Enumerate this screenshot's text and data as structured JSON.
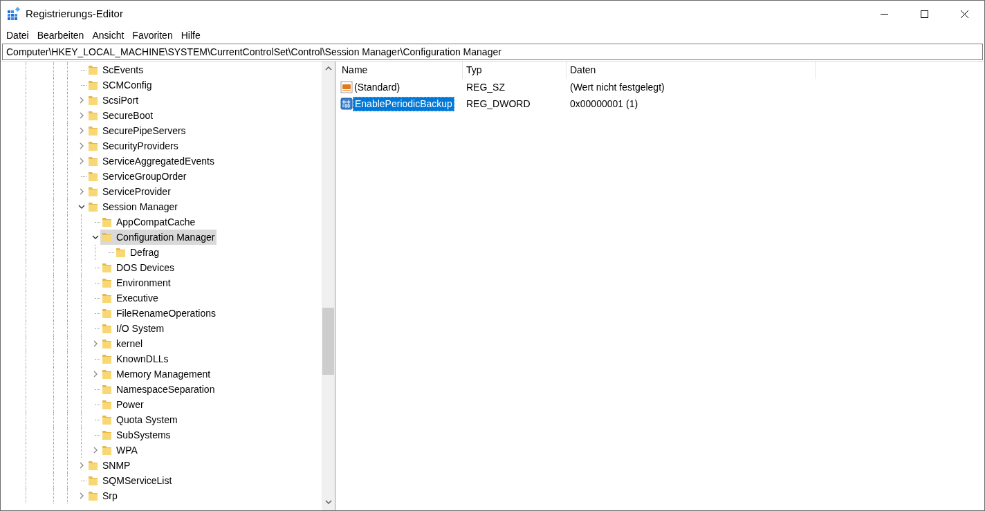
{
  "window": {
    "title": "Registrierungs-Editor"
  },
  "menu": [
    "Datei",
    "Bearbeiten",
    "Ansicht",
    "Favoriten",
    "Hilfe"
  ],
  "address": "Computer\\HKEY_LOCAL_MACHINE\\SYSTEM\\CurrentControlSet\\Control\\Session Manager\\Configuration Manager",
  "tree": [
    {
      "label": "ScEvents",
      "kind": "leaf",
      "selected": false
    },
    {
      "label": "SCMConfig",
      "kind": "leaf",
      "selected": false
    },
    {
      "label": "ScsiPort",
      "kind": "expandable",
      "expanded": false,
      "selected": false
    },
    {
      "label": "SecureBoot",
      "kind": "expandable",
      "expanded": false,
      "selected": false
    },
    {
      "label": "SecurePipeServers",
      "kind": "expandable",
      "expanded": false,
      "selected": false
    },
    {
      "label": "SecurityProviders",
      "kind": "expandable",
      "expanded": false,
      "selected": false
    },
    {
      "label": "ServiceAggregatedEvents",
      "kind": "expandable",
      "expanded": false,
      "selected": false
    },
    {
      "label": "ServiceGroupOrder",
      "kind": "leaf",
      "selected": false
    },
    {
      "label": "ServiceProvider",
      "kind": "expandable",
      "expanded": false,
      "selected": false
    },
    {
      "label": "Session Manager",
      "kind": "expandable",
      "expanded": true,
      "selected": false,
      "children": [
        {
          "label": "AppCompatCache",
          "kind": "leaf",
          "selected": false
        },
        {
          "label": "Configuration Manager",
          "kind": "expandable",
          "expanded": true,
          "selected": true,
          "children": [
            {
              "label": "Defrag",
              "kind": "leaf",
              "selected": false
            }
          ]
        },
        {
          "label": "DOS Devices",
          "kind": "leaf",
          "selected": false
        },
        {
          "label": "Environment",
          "kind": "leaf",
          "selected": false
        },
        {
          "label": "Executive",
          "kind": "leaf",
          "selected": false
        },
        {
          "label": "FileRenameOperations",
          "kind": "leaf",
          "selected": false
        },
        {
          "label": "I/O System",
          "kind": "leaf",
          "selected": false
        },
        {
          "label": "kernel",
          "kind": "expandable",
          "expanded": false,
          "selected": false
        },
        {
          "label": "KnownDLLs",
          "kind": "leaf",
          "selected": false
        },
        {
          "label": "Memory Management",
          "kind": "expandable",
          "expanded": false,
          "selected": false
        },
        {
          "label": "NamespaceSeparation",
          "kind": "leaf",
          "selected": false
        },
        {
          "label": "Power",
          "kind": "leaf",
          "selected": false
        },
        {
          "label": "Quota System",
          "kind": "leaf",
          "selected": false
        },
        {
          "label": "SubSystems",
          "kind": "leaf",
          "selected": false
        },
        {
          "label": "WPA",
          "kind": "expandable",
          "expanded": false,
          "selected": false
        }
      ]
    },
    {
      "label": "SNMP",
      "kind": "expandable",
      "expanded": false,
      "selected": false
    },
    {
      "label": "SQMServiceList",
      "kind": "leaf",
      "selected": false
    },
    {
      "label": "Srp",
      "kind": "expandable",
      "expanded": false,
      "selected": false
    }
  ],
  "table": {
    "columns": [
      "Name",
      "Typ",
      "Daten"
    ],
    "rows": [
      {
        "kind": "string",
        "name": "(Standard)",
        "type": "REG_SZ",
        "data": "(Wert nicht festgelegt)",
        "selected": false
      },
      {
        "kind": "binary",
        "name": "EnablePeriodicBackup",
        "type": "REG_DWORD",
        "data": "0x00000001 (1)",
        "selected": true
      }
    ]
  }
}
